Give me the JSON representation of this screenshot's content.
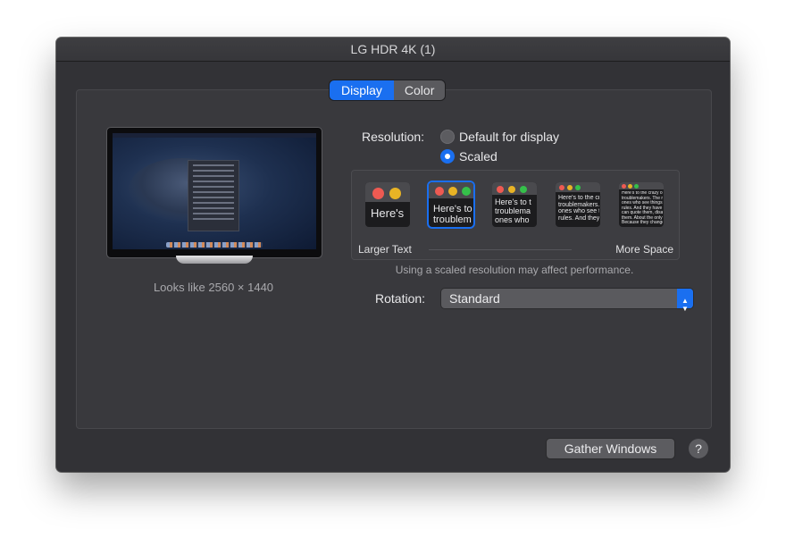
{
  "window": {
    "title": "LG HDR 4K (1)"
  },
  "tabs": [
    {
      "label": "Display",
      "active": true
    },
    {
      "label": "Color",
      "active": false
    }
  ],
  "preview": {
    "looks_like": "Looks like 2560 × 1440"
  },
  "resolution": {
    "label": "Resolution:",
    "options": [
      {
        "label": "Default for display",
        "selected": false
      },
      {
        "label": "Scaled",
        "selected": true
      }
    ]
  },
  "scaled_options": [
    {
      "text": "Here's"
    },
    {
      "text": "Here's to\ntroublem",
      "selected": true
    },
    {
      "text": "Here's to t\ntroublema\nones who"
    },
    {
      "text": "Here's to the cr\ntroublemakers.\nones who see t\nrules. And they"
    },
    {
      "text": "Here's to the crazy one\ntroublemakers. The rou\nones who see things dif\nrules. And they have no\ncan quote them, disagre\nthem. About the only th\nBecause they change th"
    }
  ],
  "scale_labels": {
    "left": "Larger Text",
    "right": "More Space"
  },
  "warning": "Using a scaled resolution may affect performance.",
  "rotation": {
    "label": "Rotation:",
    "value": "Standard"
  },
  "buttons": {
    "gather": "Gather Windows",
    "help": "?"
  },
  "colors": {
    "accent": "#1a6ff0",
    "traffic_red": "#ee5a52",
    "traffic_yellow": "#e8b325",
    "traffic_green": "#35c04a"
  }
}
